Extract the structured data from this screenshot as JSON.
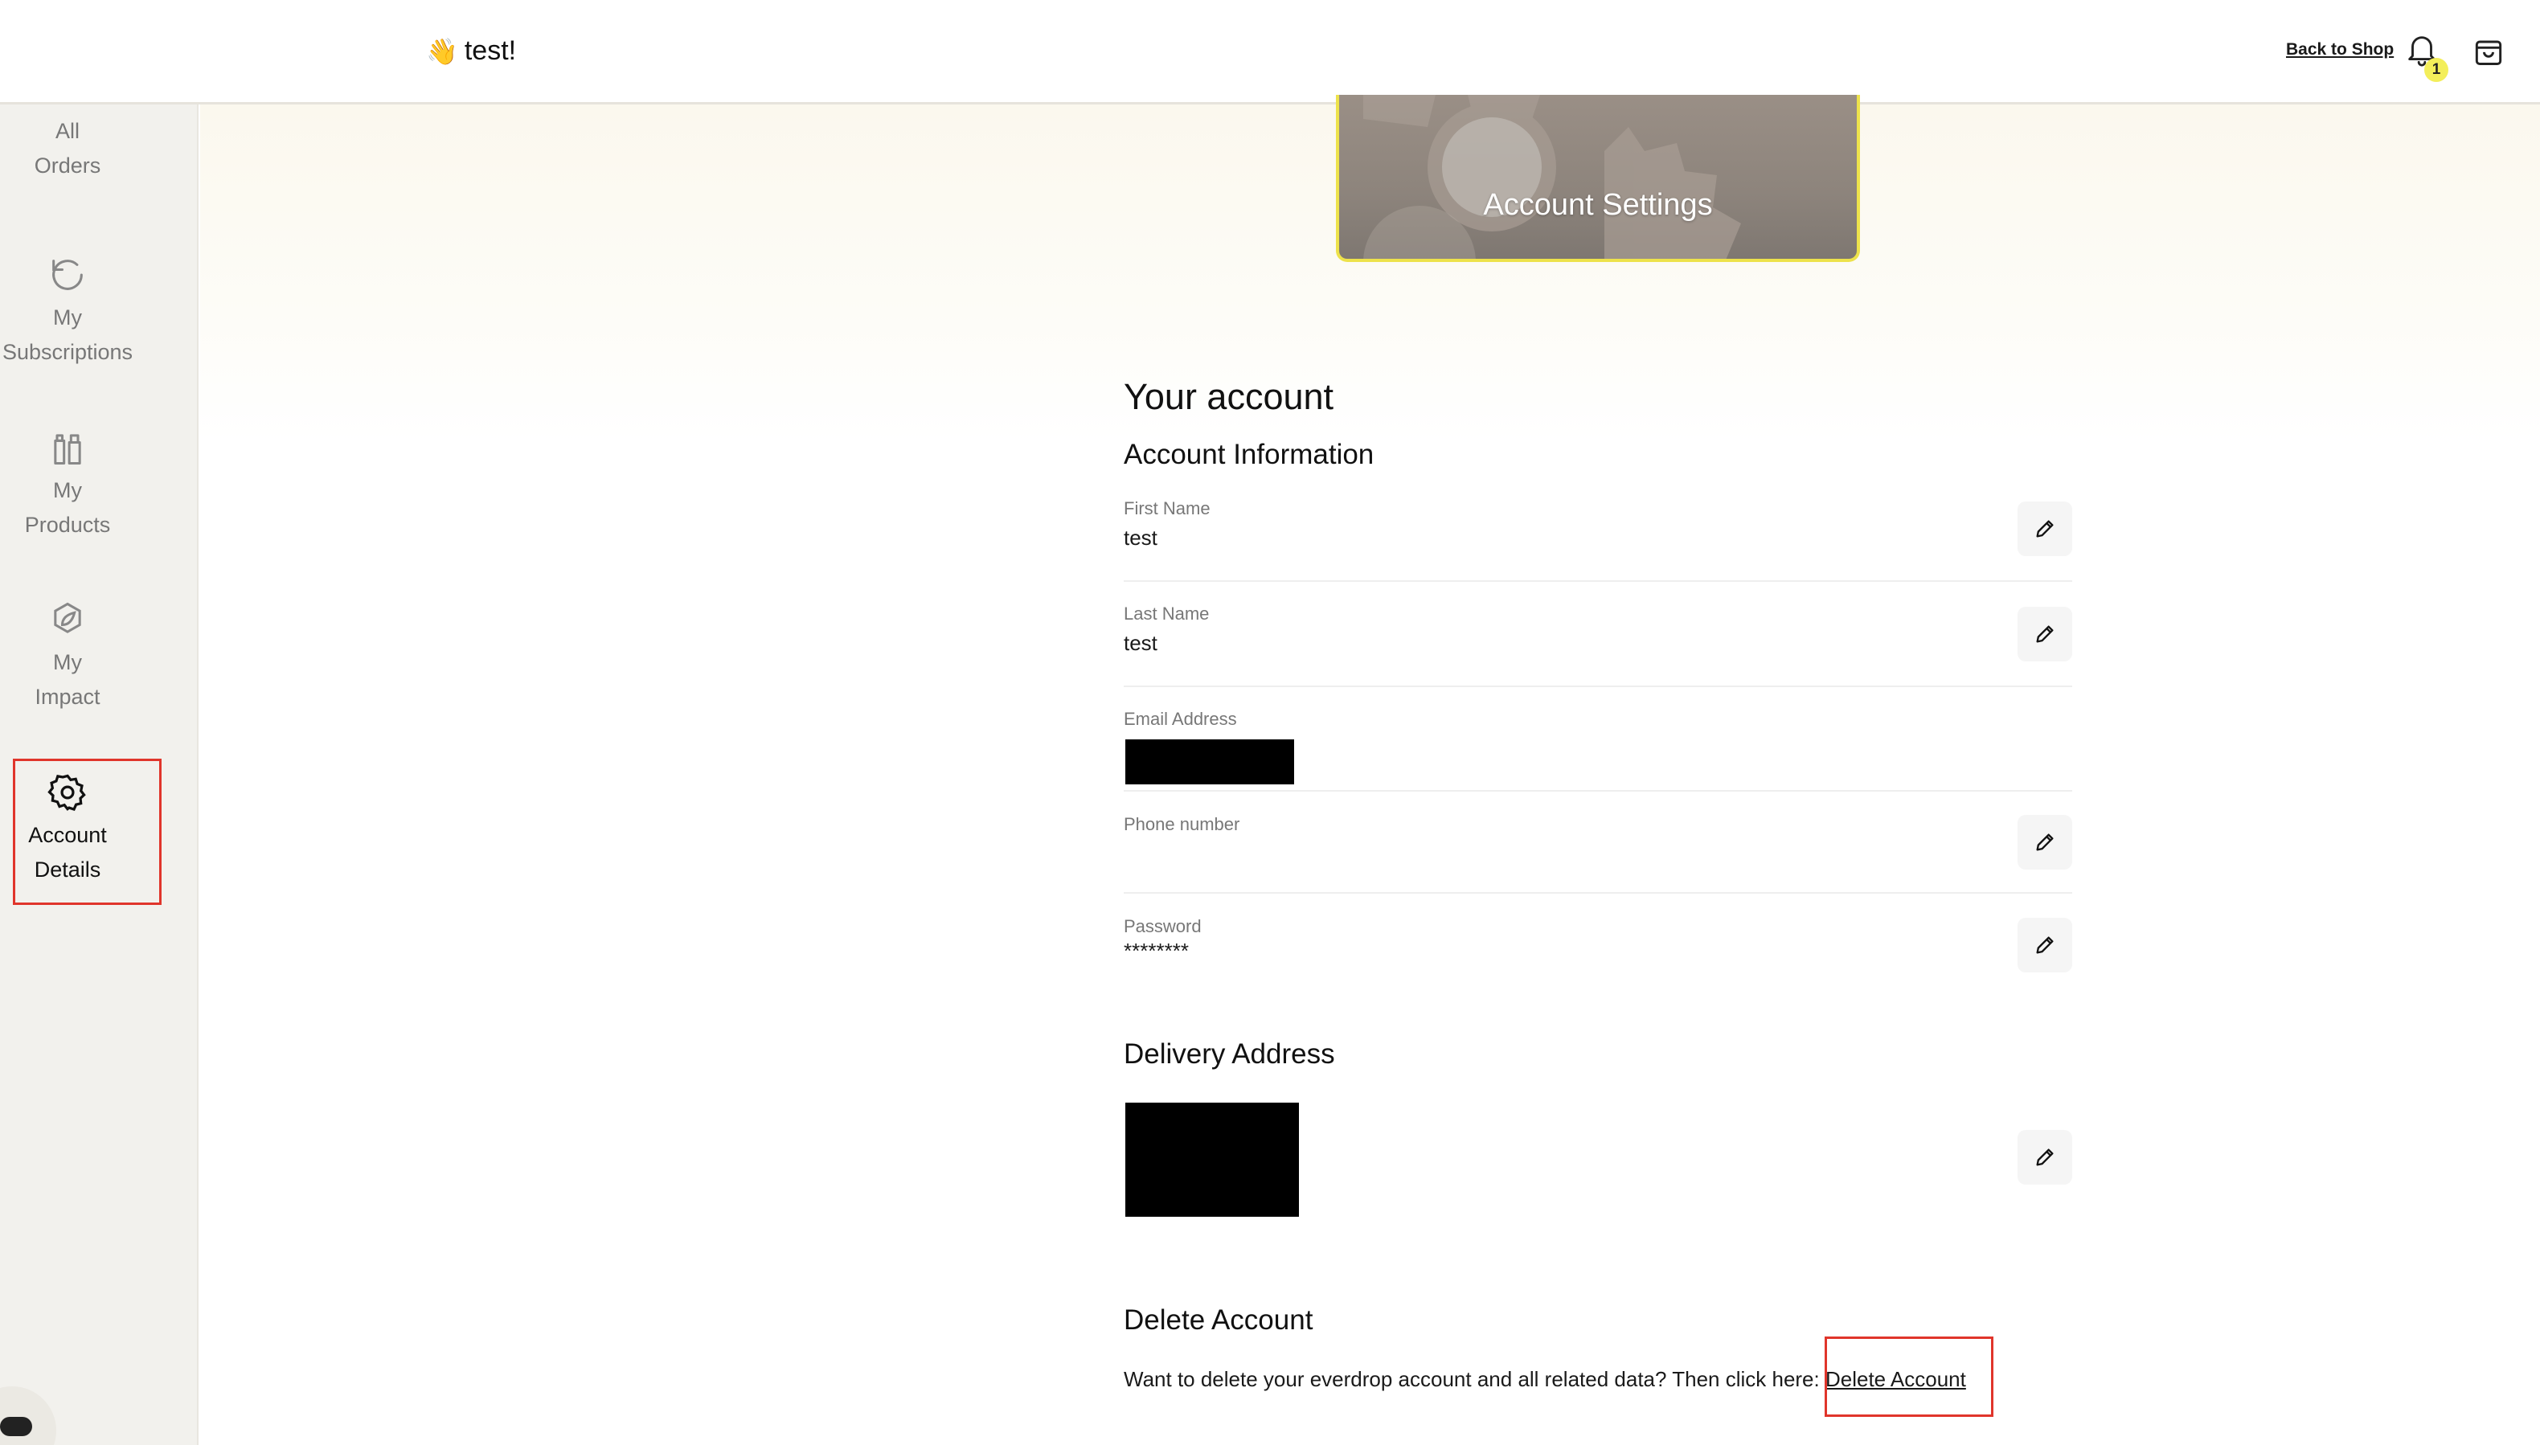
{
  "header": {
    "greeting_emoji": "👋",
    "greeting": "test!",
    "back_link": "Back to Shop",
    "notification_count": "1",
    "badge_color": "#f3ee5a"
  },
  "sidebar": {
    "items": [
      {
        "icon": "truck-icon",
        "line1": "All",
        "line2": "Orders"
      },
      {
        "icon": "refresh-icon",
        "line1": "My",
        "line2": "Subscriptions"
      },
      {
        "icon": "bottles-icon",
        "line1": "My",
        "line2": "Products"
      },
      {
        "icon": "leaf-icon",
        "line1": "My",
        "line2": "Impact"
      },
      {
        "icon": "gear-icon",
        "line1": "Account",
        "line2": "Details",
        "active": true
      }
    ]
  },
  "hero": {
    "title": "Account Settings"
  },
  "account": {
    "heading": "Your account",
    "info_heading": "Account Information",
    "fields": [
      {
        "label": "First Name",
        "value": "test",
        "editable": true
      },
      {
        "label": "Last Name",
        "value": "test",
        "editable": true
      },
      {
        "label": "Email Address",
        "value": "",
        "editable": false,
        "redacted": true
      },
      {
        "label": "Phone number",
        "value": "",
        "editable": true
      },
      {
        "label": "Password",
        "value": "********",
        "editable": true
      }
    ],
    "delivery_heading": "Delivery Address",
    "delete_heading": "Delete Account",
    "delete_text": "Want to delete your everdrop account and all related data? Then click here: ",
    "delete_link": "Delete Account"
  },
  "colors": {
    "highlight": "#e0352b",
    "hero_border": "#ede24b"
  }
}
